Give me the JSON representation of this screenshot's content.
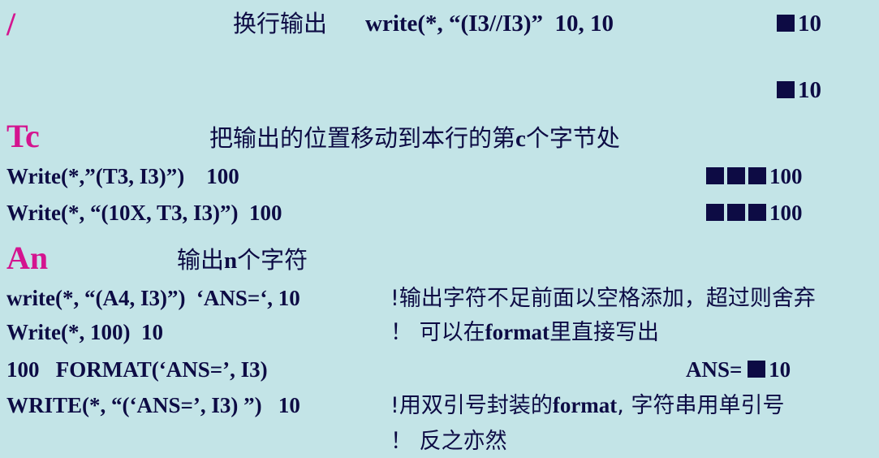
{
  "slash": {
    "code": "/",
    "desc": "换行输出",
    "example": "write(*, “(I3//I3)”  10, 10",
    "out1": "10",
    "out2": "10"
  },
  "tc": {
    "code": "Tc",
    "desc_a": "把输出的位置移动到本行的第",
    "desc_b": "c",
    "desc_c": "个字节处",
    "ex1": "Write(*,”(T3, I3)”)    100",
    "ex1_out": "100",
    "ex2": "Write(*, “(10X, T3, I3)”)  100",
    "ex2_out": "100"
  },
  "an": {
    "code": "An",
    "desc_a": "输出",
    "desc_b": "n",
    "desc_c": "个字符",
    "line1_code": "write(*, “(A4, I3)”)  ‘ANS=‘, 10",
    "line1_note": "!输出字符不足前面以空格添加，超过则舍弃",
    "line2_code": "Write(*, 100)  10",
    "line2_note_a": "！ 可以在",
    "line2_note_b": "format",
    "line2_note_c": "里直接写出",
    "line3_code": "100   FORMAT(‘ANS=’, I3)",
    "line3_out_a": "ANS=",
    "line3_out_b": "10",
    "line4_code": "WRITE(*, “(‘ANS=’, I3) ”)   10",
    "line4_note_a": "!用双引号封装的",
    "line4_note_b": "format",
    "line4_note_c": ", 字符串用单引号",
    "line5_note": "！ 反之亦然"
  }
}
